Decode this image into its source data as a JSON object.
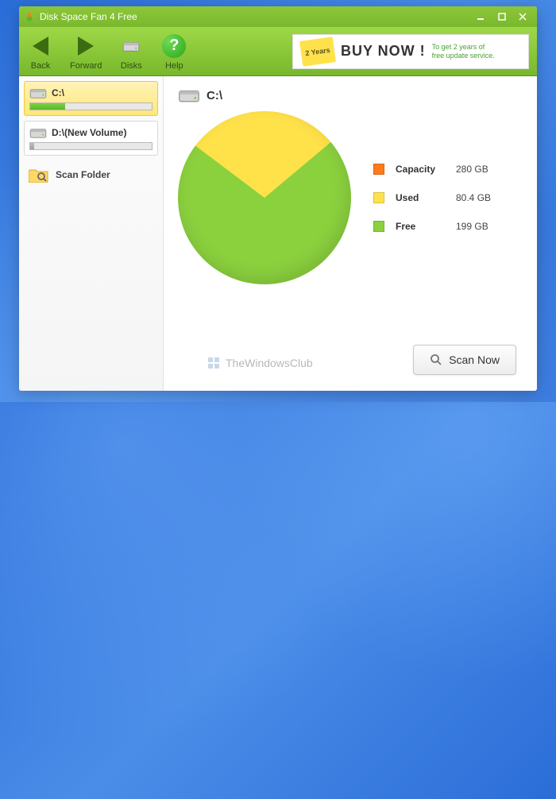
{
  "window": {
    "title": "Disk Space Fan 4 Free"
  },
  "toolbar": {
    "back": "Back",
    "forward": "Forward",
    "disks": "Disks",
    "help": "Help"
  },
  "promo": {
    "badge": "2 Years",
    "main": "BUY NOW !",
    "sub1": "To get 2 years of",
    "sub2": "free update service."
  },
  "sidebar": {
    "drives": [
      {
        "label": "C:\\",
        "used_pct": 29,
        "selected": true
      },
      {
        "label": "D:\\(New Volume)",
        "used_pct": 3,
        "selected": false
      }
    ],
    "scan_folder": "Scan Folder"
  },
  "main": {
    "drive_label": "C:\\",
    "legend": [
      {
        "label": "Capacity",
        "value": "280 GB",
        "color": "#ff7a1a"
      },
      {
        "label": "Used",
        "value": "80.4 GB",
        "color": "#ffe24a"
      },
      {
        "label": "Free",
        "value": "199 GB",
        "color": "#8bd13e"
      }
    ],
    "scan_now": "Scan Now",
    "watermark": "TheWindowsClub"
  },
  "chart_data": {
    "type": "pie",
    "title": "C:\\ disk usage",
    "series": [
      {
        "name": "Used",
        "value": 80.4,
        "unit": "GB",
        "color": "#ffe24a"
      },
      {
        "name": "Free",
        "value": 199,
        "unit": "GB",
        "color": "#8bd13e"
      }
    ],
    "total": {
      "name": "Capacity",
      "value": 280,
      "unit": "GB"
    }
  }
}
